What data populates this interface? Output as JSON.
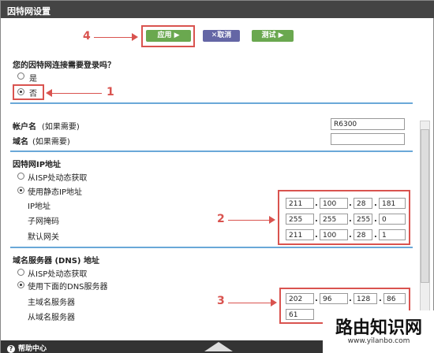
{
  "window": {
    "title": "因特网设置"
  },
  "toolbar": {
    "apply": "应用 ▶",
    "cancel": "✕取消",
    "test": "测试 ▶"
  },
  "login": {
    "question": "您的因特网连接需要登录吗？",
    "yes": "是",
    "no": "否"
  },
  "account": {
    "name_label": "帐户名",
    "name_hint": "(如果需要)",
    "name_value": "R6300",
    "domain_label": "域名",
    "domain_hint": "(如果需要)",
    "domain_value": ""
  },
  "wan": {
    "heading": "因特网IP地址",
    "isp": "从ISP处动态获取",
    "static": "使用静态IP地址",
    "ip_label": "IP地址",
    "mask_label": "子网掩码",
    "gateway_label": "默认网关",
    "ip": [
      "211",
      "100",
      "28",
      "181"
    ],
    "mask": [
      "255",
      "255",
      "255",
      "0"
    ],
    "gateway": [
      "211",
      "100",
      "28",
      "1"
    ]
  },
  "dns": {
    "heading": "域名服务器 (DNS) 地址",
    "isp": "从ISP处动态获取",
    "use": "使用下面的DNS服务器",
    "primary_label": "主域名服务器",
    "secondary_label": "从域名服务器",
    "primary": [
      "202",
      "96",
      "128",
      "86"
    ],
    "secondary_first": "61"
  },
  "annotations": {
    "m1": "1",
    "m2": "2",
    "m3": "3",
    "m4": "4"
  },
  "footer": {
    "help": "帮助中心",
    "help_icon": "?"
  },
  "watermark": {
    "title": "路由知识网",
    "url": "www.yilanbo.com"
  },
  "colors": {
    "accent_green": "#6aa84f",
    "accent_purple": "#6466a5",
    "annotation_red": "#d9534f",
    "rule_blue": "#6aa8d8"
  }
}
